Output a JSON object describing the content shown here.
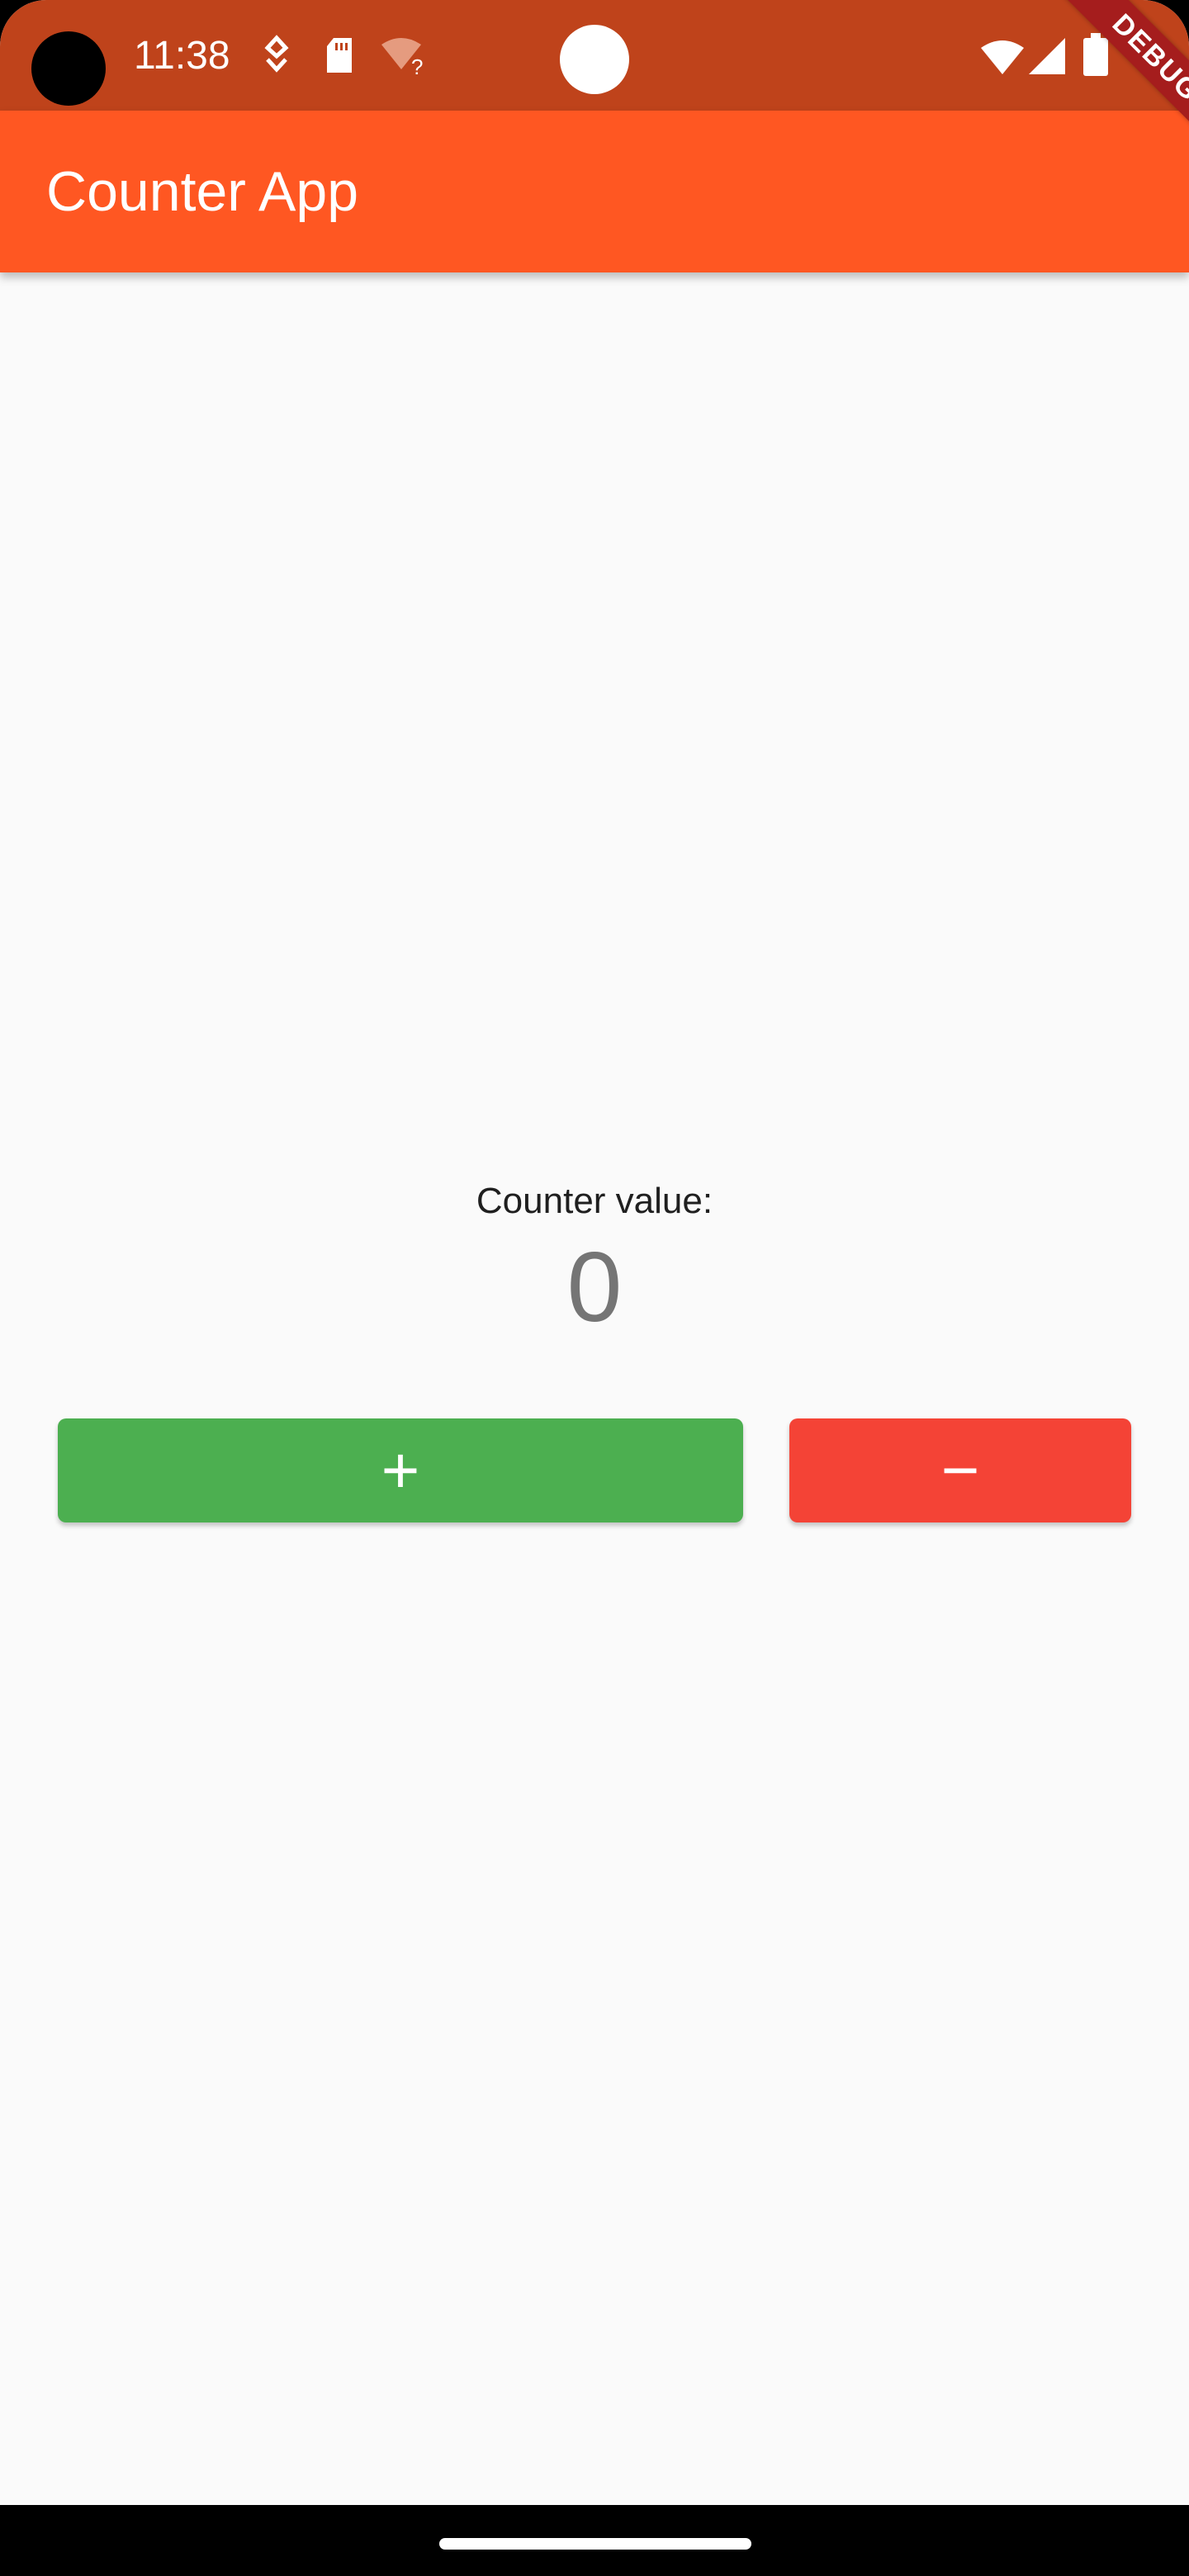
{
  "status_bar": {
    "time": "11:38",
    "icons": [
      "location-icon",
      "sd-card-icon",
      "wifi-off-icon",
      "wifi-icon",
      "signal-icon",
      "battery-icon"
    ]
  },
  "app_bar": {
    "title": "Counter App"
  },
  "debug_banner": {
    "label": "DEBUG"
  },
  "counter": {
    "label": "Counter value:",
    "value": "0"
  },
  "buttons": {
    "increment_label": "+",
    "decrement_label": "−"
  },
  "colors": {
    "status_bar": "#bf431b",
    "app_bar": "#ff5722",
    "increment": "#4caf50",
    "decrement": "#f44336",
    "background": "#fafafa"
  }
}
